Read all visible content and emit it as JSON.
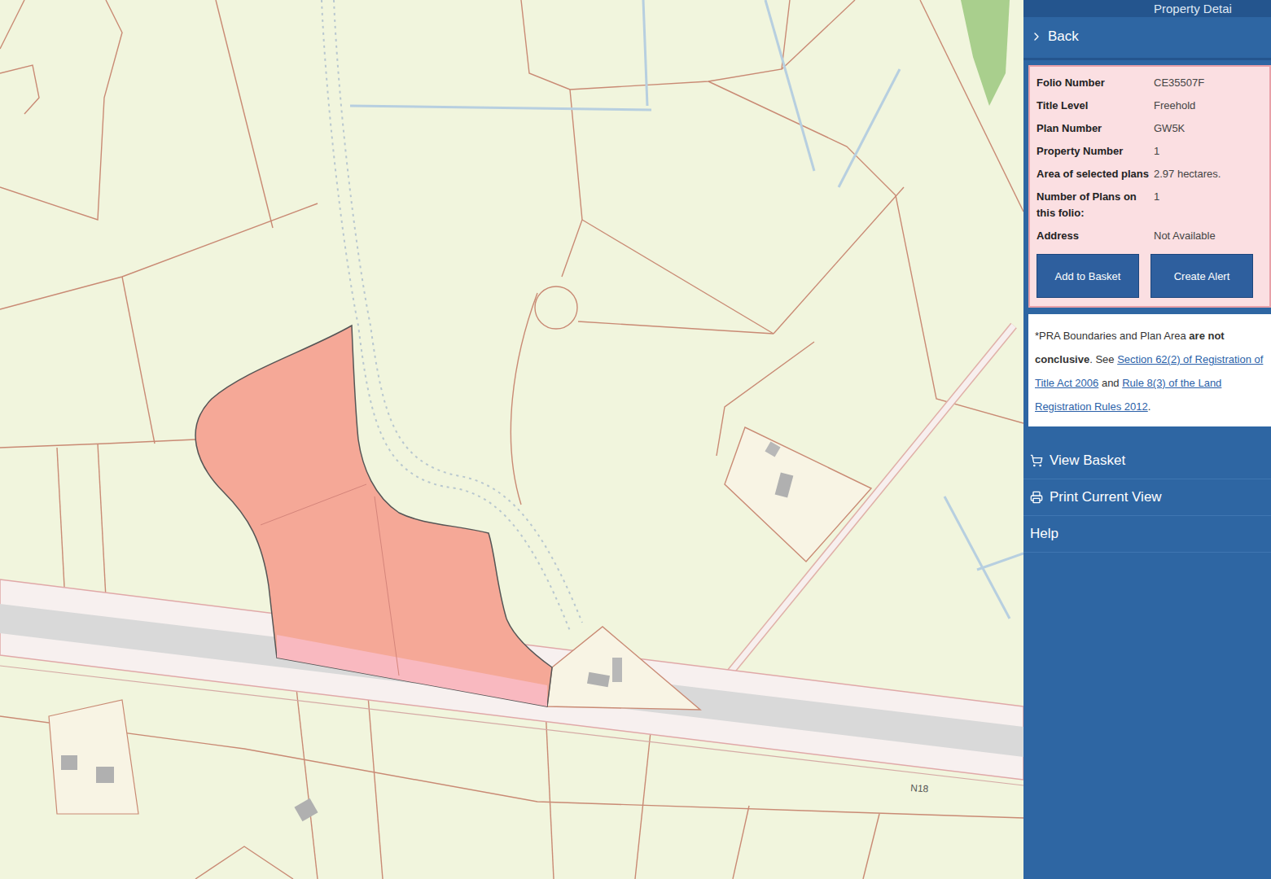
{
  "header": {
    "title": "Property Detai"
  },
  "nav": {
    "back": "Back"
  },
  "details": [
    {
      "label": "Folio Number",
      "value": "CE35507F"
    },
    {
      "label": "Title Level",
      "value": "Freehold"
    },
    {
      "label": "Plan Number",
      "value": "GW5K"
    },
    {
      "label": "Property Number",
      "value": "1"
    },
    {
      "label": "Area of selected plans",
      "value": "2.97 hectares."
    },
    {
      "label": "Number of Plans on this folio:",
      "value": "1"
    },
    {
      "label": "Address",
      "value": "Not Available"
    }
  ],
  "actions": [
    "Add to Basket",
    "Create Alert"
  ],
  "notice": [
    {
      "text": "*PRA Boundaries and Plan Area ",
      "kind": "plain"
    },
    {
      "text": "are not conclusive",
      "kind": "bold"
    },
    {
      "text": ". See ",
      "kind": "plain"
    },
    {
      "text": "Section 62(2) of Registration of Title Act 2006",
      "kind": "link"
    },
    {
      "text": " and ",
      "kind": "plain"
    },
    {
      "text": "Rule 8(3) of the Land Registration Rules 2012",
      "kind": "link"
    },
    {
      "text": ".",
      "kind": "plain"
    }
  ],
  "menu": [
    {
      "label": "View Basket",
      "kind": "cart"
    },
    {
      "label": "Print Current View",
      "kind": "print"
    },
    {
      "label": "Help",
      "kind": "plain"
    }
  ],
  "map": {
    "road_label": "N18"
  }
}
